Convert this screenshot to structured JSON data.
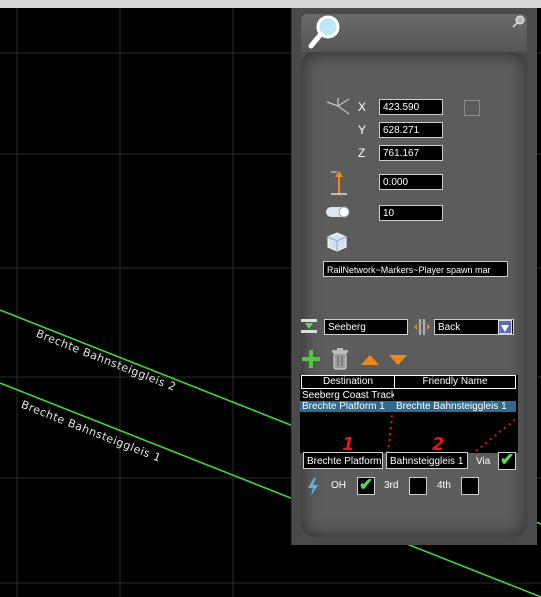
{
  "viewport": {
    "track_labels": [
      {
        "text": "Brechte Bahnsteiggleis 2"
      },
      {
        "text": "Brechte Bahnsteiggleis 1"
      }
    ],
    "colors": {
      "grid": "#2b2b2b",
      "track": "#44d23a",
      "background": "#000000"
    }
  },
  "panel": {
    "search_icon": "magnifier-icon",
    "pin_icon": "pin-icon",
    "position": {
      "x_label": "X",
      "x_value": "423.590",
      "y_label": "Y",
      "y_value": "628.271",
      "z_label": "Z",
      "z_value": "761.167"
    },
    "height_value": "0.000",
    "length_value": "10",
    "object_name": "RailNetwork~Markers~Player spawn mar",
    "route_name": "Seeberg",
    "direction_value": "Back",
    "table": {
      "headers": [
        "Destination",
        "Friendly Name"
      ],
      "rows": [
        {
          "destination": "Seeberg Coast Track",
          "friendly": ""
        },
        {
          "destination": "Brechte Platform 1",
          "friendly": "Brechte Bahnsteiggleis 1"
        }
      ]
    },
    "badges": [
      "1",
      "2"
    ],
    "edit_fields": [
      "Brechte Platform",
      "Bahnsteiggleis 1"
    ],
    "via_label": "Via",
    "options": {
      "oh_label": "OH",
      "third_label": "3rd",
      "fourth_label": "4th"
    },
    "colors": {
      "panel": "#4a4a4a",
      "selected_row": "#2e6b8e",
      "check": "#5bd75b",
      "accent": "#f08a1c"
    }
  }
}
